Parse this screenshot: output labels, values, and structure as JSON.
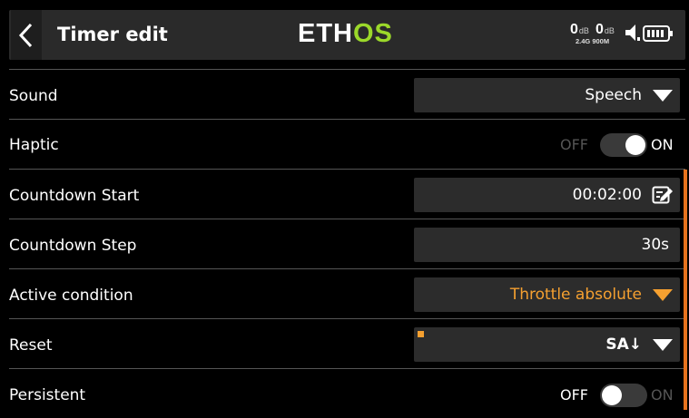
{
  "header": {
    "back_icon": "chevron-left-icon",
    "title": "Timer edit",
    "logo_part1": "ETH",
    "logo_part2": "OS",
    "rssi_24": "0",
    "rssi_24_unit": "dB",
    "rssi_900": "0",
    "rssi_900_unit": "dB",
    "band_labels": "2.4G 900M",
    "volume_icon": "speaker-icon",
    "battery_icon": "battery-icon"
  },
  "rows": {
    "sound": {
      "label": "Sound",
      "value": "Speech"
    },
    "haptic": {
      "label": "Haptic",
      "off": "OFF",
      "on": "ON",
      "state": "on"
    },
    "countdown_start": {
      "label": "Countdown Start",
      "value": "00:02:00",
      "icon": "edit-icon"
    },
    "countdown_step": {
      "label": "Countdown Step",
      "value": "30s"
    },
    "active_condition": {
      "label": "Active condition",
      "value": "Throttle absolute"
    },
    "reset": {
      "label": "Reset",
      "value": "SA↓"
    },
    "persistent": {
      "label": "Persistent",
      "off": "OFF",
      "on": "ON",
      "state": "off"
    }
  },
  "colors": {
    "accent_orange": "#f5a030",
    "logo_green": "#9bd82a",
    "scrollbar": "#e8731e",
    "field_bg": "#2c2c2c"
  }
}
